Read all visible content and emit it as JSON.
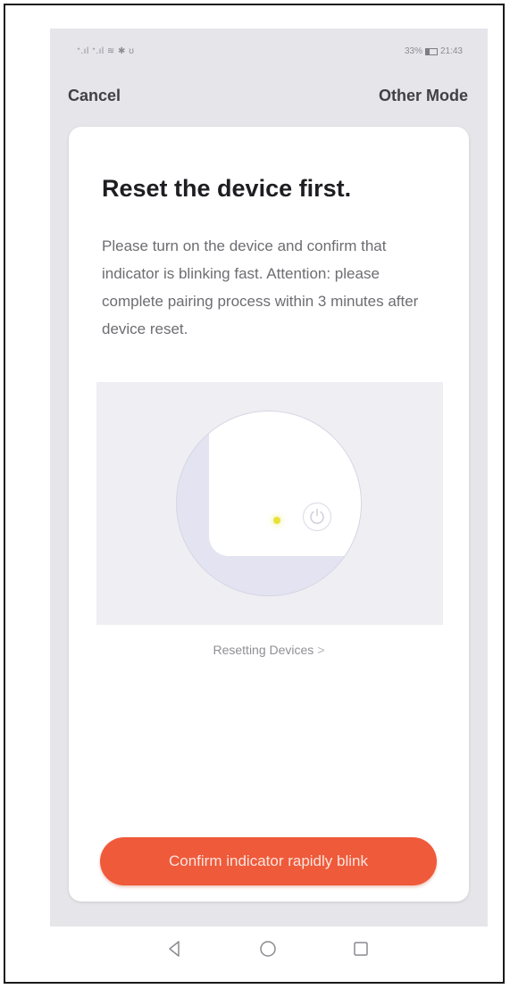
{
  "status_bar": {
    "left": "ᐩ.ıl ᐩ.ıl ≋ ✱ ʊ",
    "battery": "33%",
    "time": "21:43"
  },
  "nav": {
    "cancel_label": "Cancel",
    "other_mode_label": "Other Mode"
  },
  "card": {
    "title": "Reset the device first.",
    "description": "Please turn on the device and confirm that indicator is blinking fast. Attention: please complete pairing process within 3 minutes after device reset.",
    "help_link_label": "Resetting Devices",
    "help_link_chevron": ">",
    "confirm_button_label": "Confirm indicator rapidly blink"
  },
  "icons": {
    "power": "power-icon",
    "indicator": "indicator-led-icon",
    "back": "back-triangle-icon",
    "home": "home-circle-icon",
    "recents": "recents-square-icon"
  },
  "colors": {
    "accent": "#ef5a3a",
    "indicator": "#e6e23a",
    "background": "#e6e5ea",
    "card": "#ffffff"
  }
}
